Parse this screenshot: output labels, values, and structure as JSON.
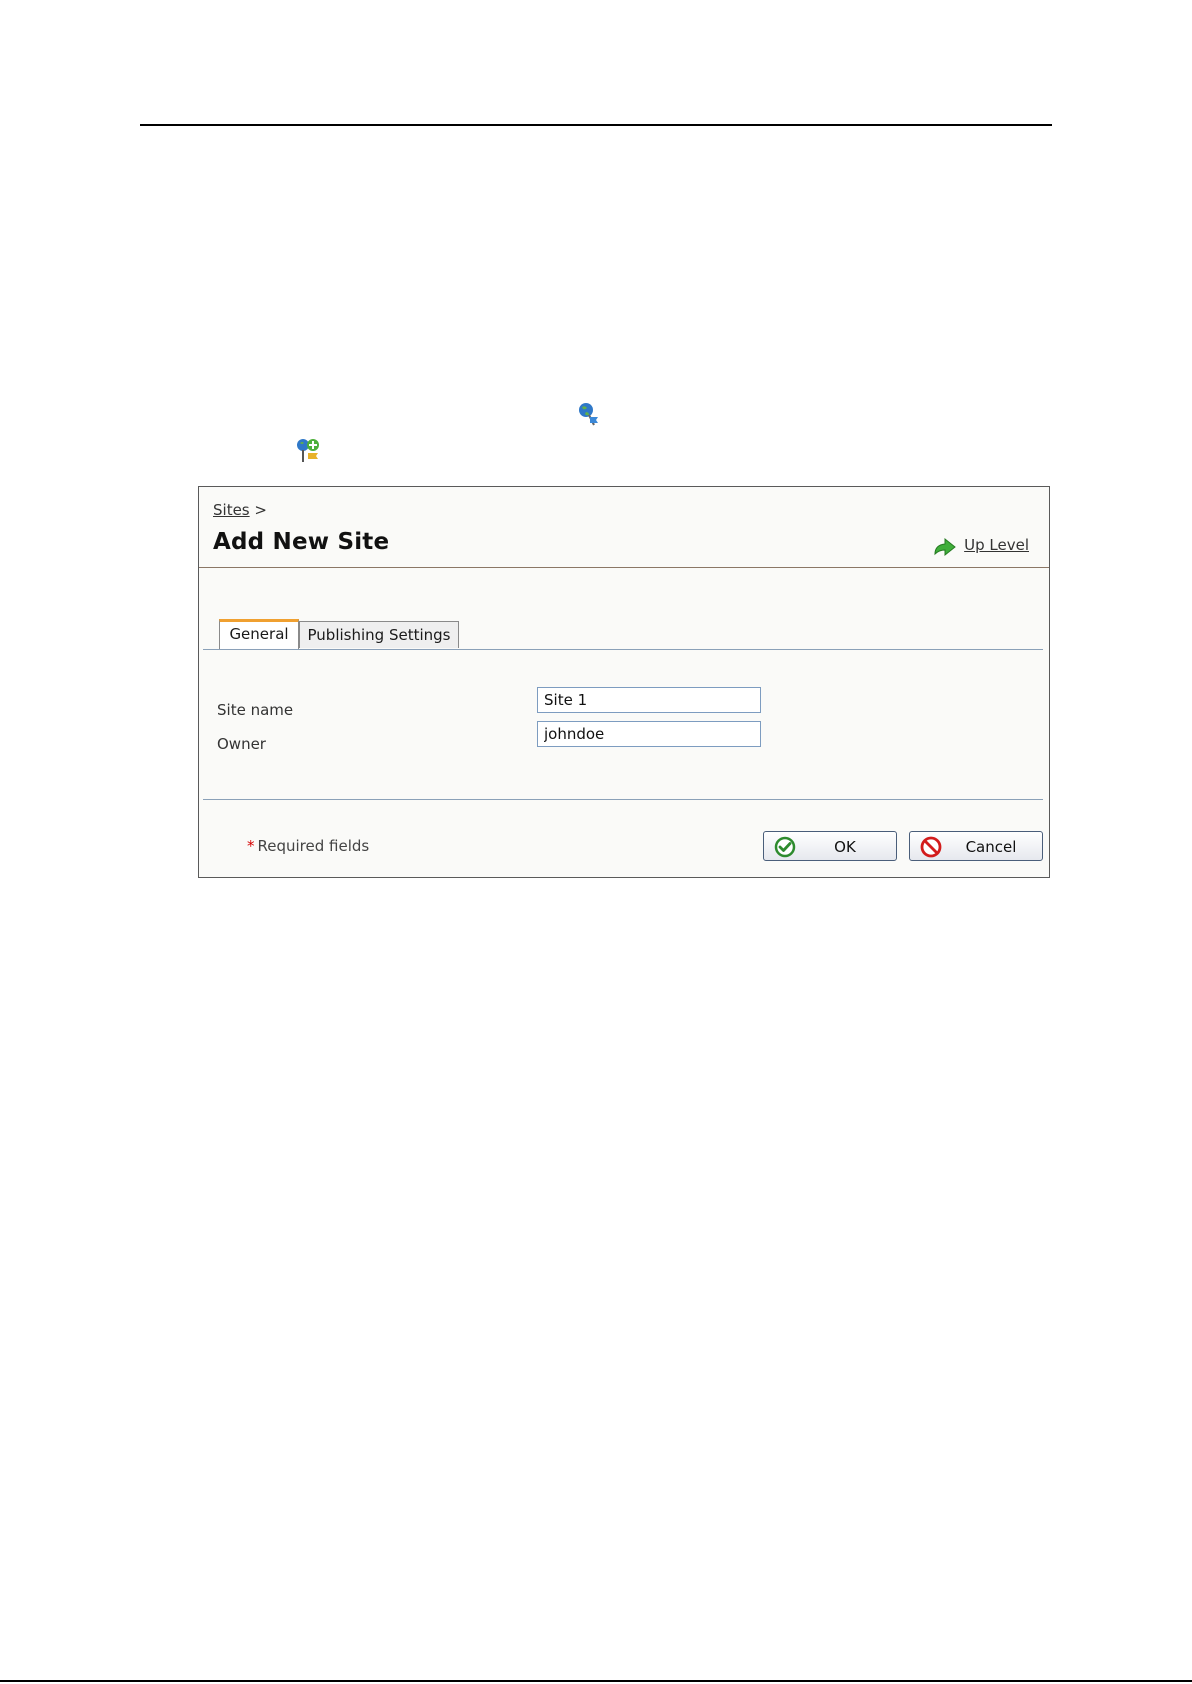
{
  "breadcrumb": {
    "sites_link": "Sites",
    "separator": ">"
  },
  "page": {
    "title": "Add New Site",
    "up_level": "Up Level"
  },
  "tabs": [
    {
      "label": "General",
      "active": true
    },
    {
      "label": "Publishing Settings",
      "active": false
    }
  ],
  "form": {
    "site_name": {
      "label": "Site name",
      "value": "Site 1"
    },
    "owner": {
      "label": "Owner",
      "value": "johndoe"
    }
  },
  "footer": {
    "required_star": "*",
    "required_text": "Required fields"
  },
  "buttons": {
    "ok": "OK",
    "cancel": "Cancel"
  },
  "icons": {
    "inline_sites": "sites-globe-icon",
    "inline_add_site": "add-site-icon",
    "up_level": "up-arrow-icon",
    "ok": "check-circle-icon",
    "cancel": "no-entry-icon"
  },
  "colors": {
    "active_tab_accent": "#f0a030",
    "input_border": "#7d9cc0",
    "required_star": "#d40000"
  }
}
